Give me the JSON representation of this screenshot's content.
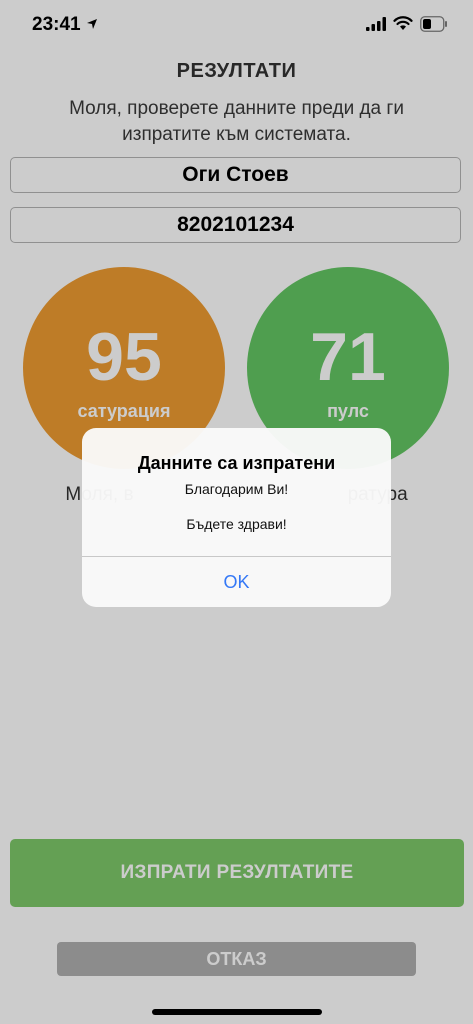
{
  "status_bar": {
    "time": "23:41"
  },
  "header": {
    "title": "РЕЗУЛТАТИ",
    "subtitle": "Моля, проверете данните преди да ги изпратите към системата."
  },
  "fields": {
    "name": "Оги Стоев",
    "id_number": "8202101234"
  },
  "measurements": {
    "saturation": {
      "value": "95",
      "label": "сатурация",
      "color": "#ee9c31"
    },
    "pulse": {
      "value": "71",
      "label": "пулс",
      "color": "#63c663"
    }
  },
  "hint": {
    "left": "Моля, в",
    "right": "ратура"
  },
  "buttons": {
    "send": "ИЗПРАТИ РЕЗУЛТАТИТЕ",
    "cancel": "ОТКАЗ"
  },
  "alert": {
    "title": "Данните са изпратени",
    "line1": "Благодарим Ви!",
    "line2": "Бъдете здрави!",
    "ok": "OK",
    "ok_color": "#3478f6"
  }
}
